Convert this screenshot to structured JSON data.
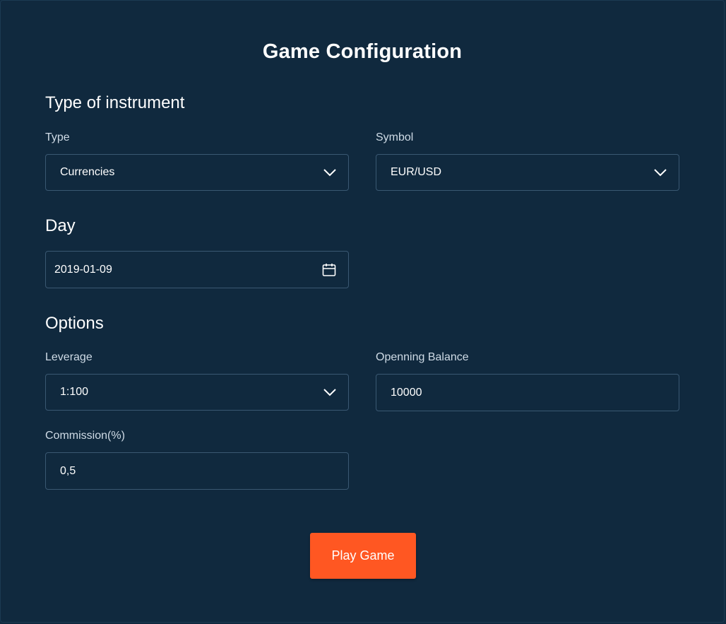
{
  "page": {
    "title": "Game Configuration"
  },
  "instrument": {
    "section_title": "Type of instrument",
    "type_label": "Type",
    "type_value": "Currencies",
    "symbol_label": "Symbol",
    "symbol_value": "EUR/USD"
  },
  "day": {
    "section_title": "Day",
    "date_value": "2019-01-09",
    "icon": "calendar-icon"
  },
  "options": {
    "section_title": "Options",
    "leverage_label": "Leverage",
    "leverage_value": "1:100",
    "balance_label": "Openning Balance",
    "balance_value": "10000",
    "commission_label": "Commission(%)",
    "commission_value": "0,5"
  },
  "actions": {
    "play_label": "Play Game"
  },
  "colors": {
    "background": "#10293e",
    "border": "#3a5872",
    "accent": "#ff5722",
    "label": "#cfdbe6"
  }
}
